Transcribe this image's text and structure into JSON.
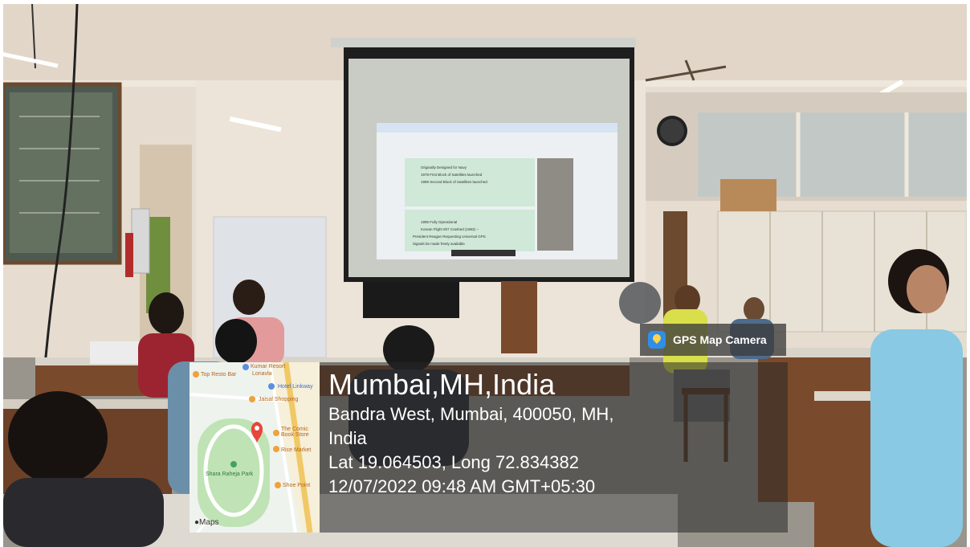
{
  "badge": {
    "label": "GPS Map Camera"
  },
  "map": {
    "labels": {
      "kumar_resort": "Kumar Resort",
      "lonavla": "Lonavla",
      "top_resto_bar": "Top Resto Bar",
      "hotel_linkway": "Hotel Linkway",
      "jaisal_shopping": "Jaisal Shopping",
      "comic_book_store": "The Comic Book Store",
      "rice_market": "Rice Market",
      "shara_raheja_park": "Shara Raheja Park",
      "shoe_point": "Shoe Point"
    },
    "brand": "Maps"
  },
  "location": {
    "city": "Mumbai,MH,India",
    "address_line1": "Bandra West, Mumbai, 400050, MH,",
    "address_line2": "India",
    "coordinates": "Lat 19.064503, Long 72.834382",
    "datetime": "12/07/2022 09:48 AM GMT+05:30"
  },
  "projector_screen": {
    "lines": [
      "Originally Designed for Navy",
      "1978 First Block of Satellites launched",
      "1989 Second Block of Satellites launched",
      "1995 Fully Operational",
      "Korean Flight 007 Crashed (1983) --",
      "President Reagan Requesting Universal GPS",
      "Signals be made freely available"
    ]
  },
  "colors": {
    "wall": "#e6ddd0",
    "ceiling": "#e2d6c8",
    "floor": "#9a958c",
    "wood": "#7a4a2c",
    "screen": "#c9ccc4",
    "overlay": "#282828",
    "map_bg": "#eef3ee",
    "pin": "#e8453c"
  }
}
